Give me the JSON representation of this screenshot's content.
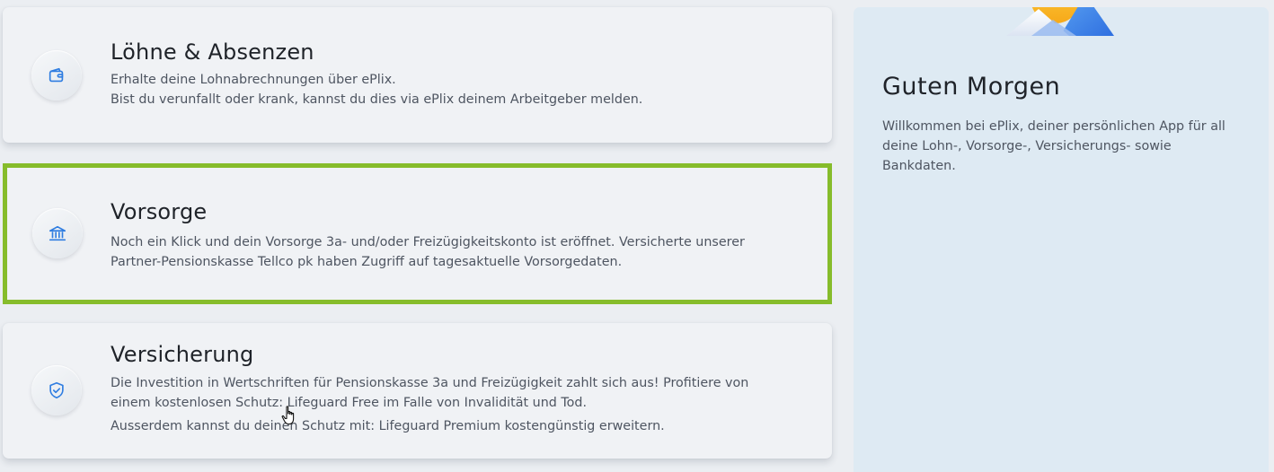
{
  "cards": [
    {
      "title": "Löhne & Absenzen",
      "icon": "wallet-icon",
      "lines": [
        "Erhalte deine Lohnabrechnungen über ePlix.",
        "Bist du verunfallt oder krank, kannst du dies via ePlix deinem Arbeitgeber melden."
      ]
    },
    {
      "title": "Vorsorge",
      "icon": "bank-icon",
      "selected": true,
      "text": "Noch ein Klick und dein Vorsorge 3a- und/oder Freizügigkeitskonto ist eröffnet. Versicherte unserer Partner-Pensionskasse Tellco pk haben Zugriff auf tagesaktuelle Vorsorgedaten."
    },
    {
      "title": "Versicherung",
      "icon": "shield-check-icon",
      "text": "Die Investition in Wertschriften für Pensionskasse 3a und Freizügigkeit zahlt sich aus! Profitiere von einem kostenlosen Schutz: Lifeguard Free im Falle von Invalidität und Tod.",
      "text2": "Ausserdem kannst du deinen Schutz mit: Lifeguard Premium kostengünstig erweitern."
    }
  ],
  "greeting": {
    "title": "Guten Morgen",
    "text": "Willkommen bei ePlix, deiner persönlichen App für all deine Lohn-, Vorsorge-, Versicherungs- sowie Bankdaten."
  },
  "colors": {
    "accent": "#2f7de1",
    "selected_border": "#86bc2b",
    "panel_bg": "#deeaf3",
    "card_bg": "#f0f2f5"
  }
}
